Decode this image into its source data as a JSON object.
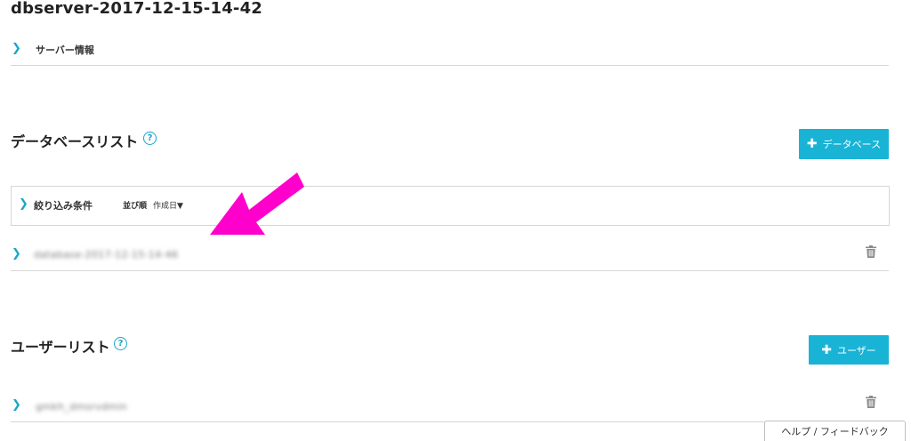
{
  "page": {
    "title": "dbserver-2017-12-15-14-42"
  },
  "server_info": {
    "label": "サーバー情報"
  },
  "database_section": {
    "title": "データベースリスト",
    "add_button_label": "データベース",
    "filter": {
      "label": "絞り込み条件",
      "sort_label": "並び順",
      "sort_value": "作成日▼"
    },
    "items": [
      {
        "name": "database-2017-12-15-14-46"
      }
    ]
  },
  "user_section": {
    "title": "ユーザーリスト",
    "add_button_label": "ユーザー",
    "items": [
      {
        "name": "gmkh_dmsrvdmin"
      }
    ]
  },
  "help_feedback": {
    "label": "ヘルプ / フィードバック"
  },
  "colors": {
    "accent": "#19b3d6",
    "arrow": "#ff00cc"
  }
}
